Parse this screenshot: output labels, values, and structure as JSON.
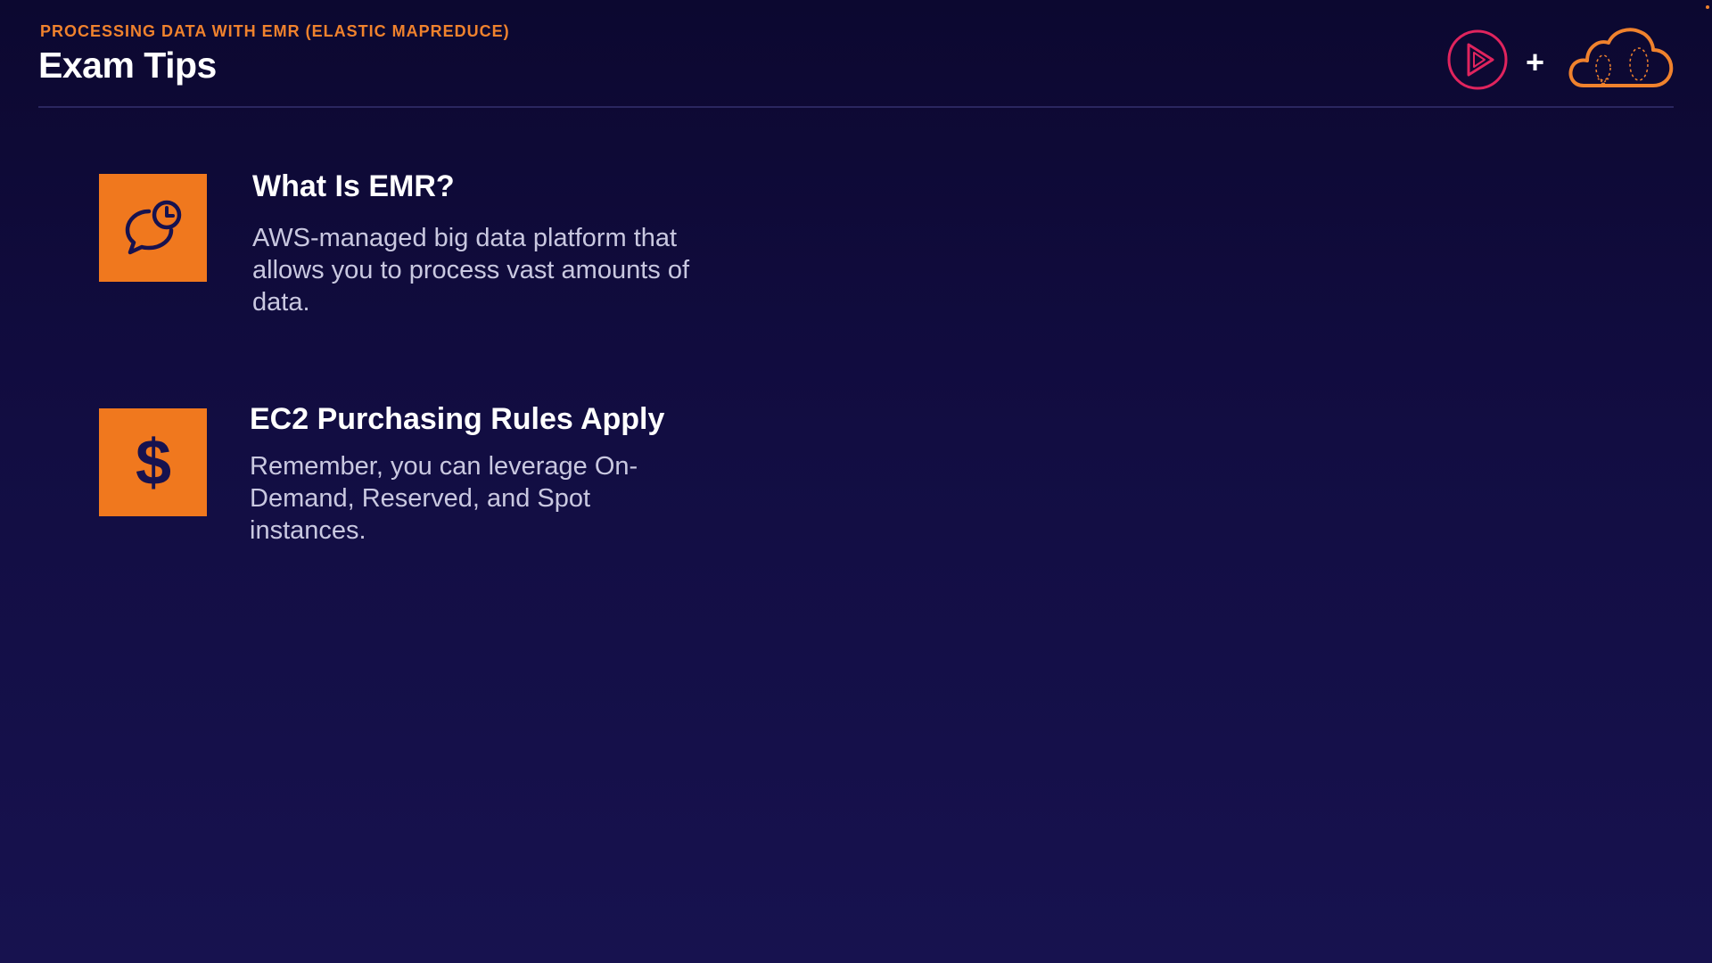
{
  "header": {
    "kicker": "PROCESSING DATA WITH EMR (ELASTIC MAPREDUCE)",
    "title": "Exam Tips",
    "plus": "+"
  },
  "logos": {
    "play_icon": "play-circle-icon",
    "cloud_icon": "cloud-icon",
    "play_color": "#e0245e",
    "cloud_color": "#f0822d"
  },
  "tips": [
    {
      "icon": "speech-bubble-clock-icon",
      "title": "What Is EMR?",
      "body": "AWS-managed big data platform that allows you to process vast amounts of data."
    },
    {
      "icon": "dollar-icon",
      "title": "EC2 Purchasing Rules Apply",
      "body": "Remember, you can leverage On-Demand, Reserved, and Spot instances."
    }
  ],
  "colors": {
    "accent": "#f0781e",
    "background": "#120d42",
    "title_text": "#ffffff",
    "body_text": "#c9c8e0"
  }
}
